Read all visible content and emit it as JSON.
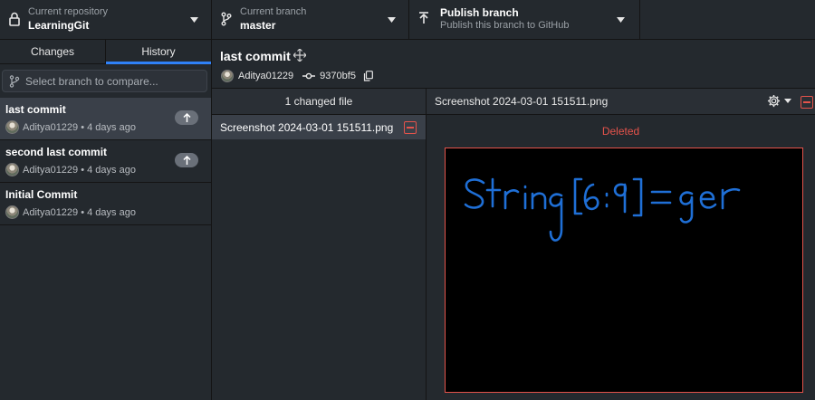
{
  "toolbar": {
    "repository": {
      "label": "Current repository",
      "value": "LearningGit",
      "icon": "lock-icon"
    },
    "branch": {
      "label": "Current branch",
      "value": "master",
      "icon": "branch-icon"
    },
    "publish": {
      "label": "Publish branch",
      "value": "Publish this branch to GitHub",
      "icon": "upload-icon"
    }
  },
  "sidebar": {
    "tabs": [
      {
        "label": "Changes",
        "active": false
      },
      {
        "label": "History",
        "active": true
      }
    ],
    "branch_compare": {
      "placeholder": "Select branch to compare..."
    },
    "commits": [
      {
        "title": "last commit",
        "meta": "Aditya01229 • 4 days ago",
        "unpushed": true,
        "selected": true
      },
      {
        "title": "second last commit",
        "meta": "Aditya01229 • 4 days ago",
        "unpushed": true,
        "selected": false
      },
      {
        "title": "Initial Commit",
        "meta": "Aditya01229 • 4 days ago",
        "unpushed": false,
        "selected": false
      }
    ]
  },
  "commit_header": {
    "title": "last commit",
    "author": "Aditya01229",
    "sha": "9370bf5"
  },
  "files": {
    "header": "1 changed file",
    "items": [
      {
        "name": "Screenshot 2024-03-01 151511.png",
        "status": "deleted"
      }
    ]
  },
  "diff": {
    "filename": "Screenshot 2024-03-01 151511.png",
    "status_label": "Deleted",
    "image_text": "String[6:9]=ger"
  },
  "colors": {
    "background": "#24292e",
    "selected": "#3a4049",
    "accent": "#2f81f7",
    "deleted": "#e5534b",
    "handwriting": "#1f6fd6"
  }
}
